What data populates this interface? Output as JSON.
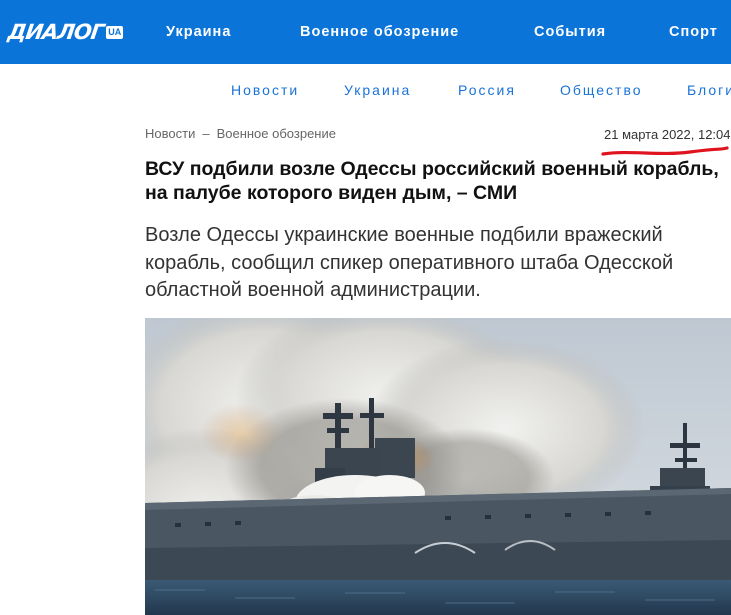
{
  "header": {
    "logo_text": "ДИАЛОГ",
    "logo_badge": "UA",
    "nav": [
      "Украина",
      "Военное обозрение",
      "События",
      "Спорт"
    ]
  },
  "subnav": [
    "Новости",
    "Украина",
    "Россия",
    "Общество",
    "Блоги"
  ],
  "article": {
    "breadcrumb": [
      "Новости",
      "–",
      "Военное обозрение"
    ],
    "date": "21 марта 2022, 12:04",
    "title": "ВСУ подбили возле Одессы российский военный корабль, на палубе которого виден дым, – СМИ",
    "lead": "Возле Одессы украинские военные подбили вражеский корабль, сообщил спикер оперативного штаба Одесской областной военной администрации."
  },
  "colors": {
    "brand_blue": "#0a74d9",
    "link_blue": "#1a73d6",
    "annotation_red": "#e0141e"
  },
  "photo": {
    "subject": "warship-with-smoke-image"
  }
}
